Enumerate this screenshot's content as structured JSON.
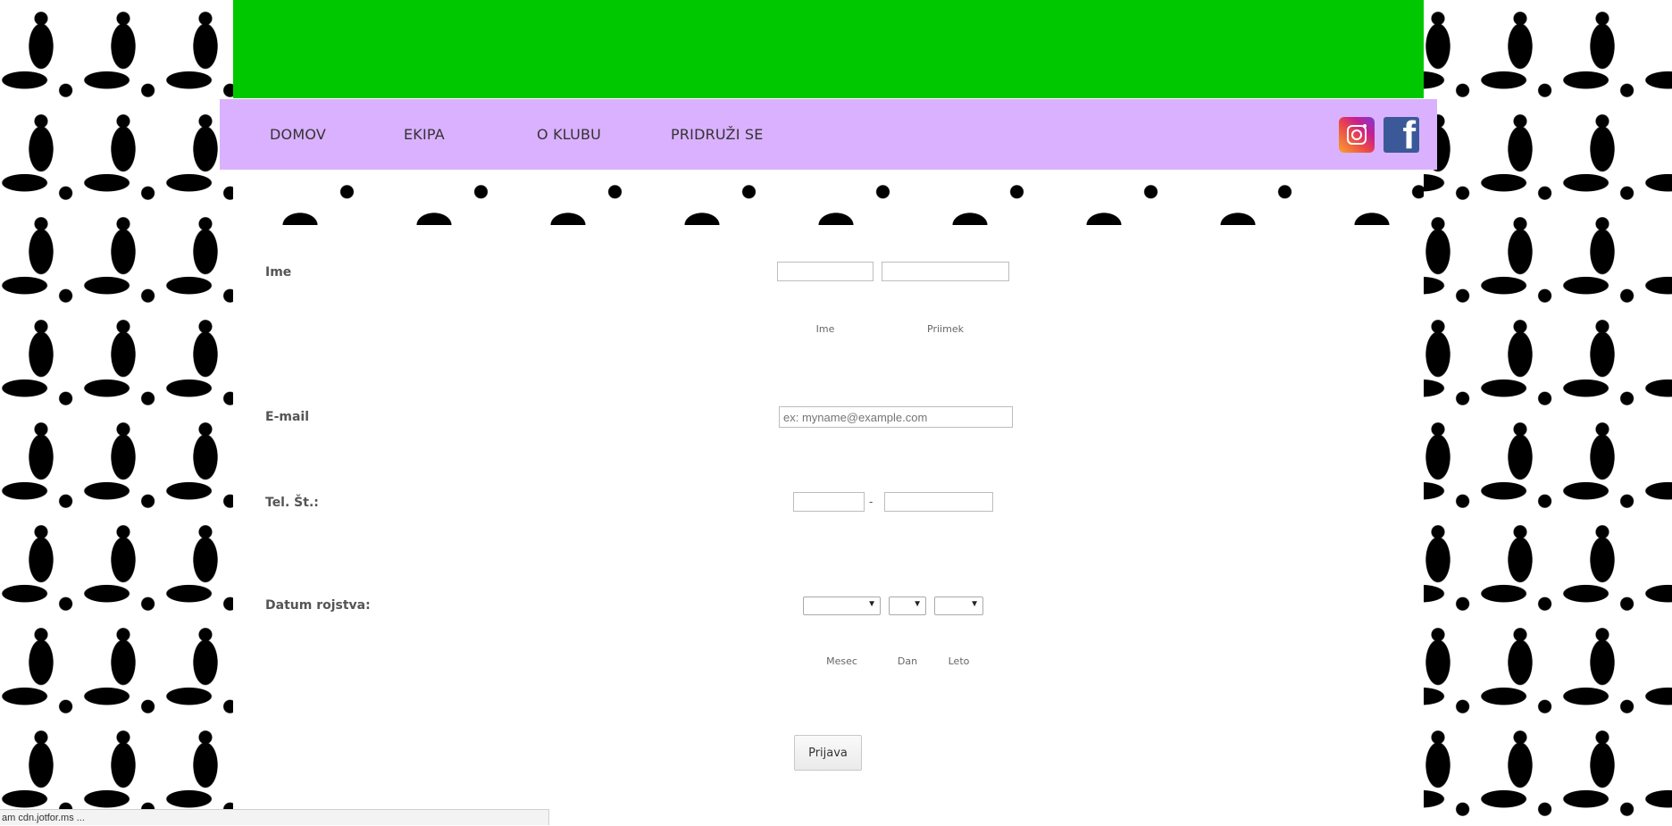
{
  "nav": {
    "items": [
      {
        "label": "DOMOV"
      },
      {
        "label": "EKIPA"
      },
      {
        "label": "O KLUBU"
      },
      {
        "label": "PRIDRUŽI SE"
      }
    ],
    "social": [
      {
        "icon": "instagram-icon"
      },
      {
        "icon": "facebook-icon"
      }
    ]
  },
  "colors": {
    "banner": "#00c800",
    "navbar": "#dab1ff",
    "facebook": "#3b5998"
  },
  "form": {
    "name": {
      "label": "Ime",
      "first_sub": "Ime",
      "last_sub": "Priimek",
      "first_value": "",
      "last_value": ""
    },
    "email": {
      "label": "E-mail",
      "placeholder": "ex: myname@example.com",
      "value": ""
    },
    "phone": {
      "label": "Tel. Št.:",
      "separator": "-",
      "area_value": "",
      "number_value": ""
    },
    "birthdate": {
      "label": "Datum rojstva:",
      "month_sub": "Mesec",
      "day_sub": "Dan",
      "year_sub": "Leto",
      "month_value": "",
      "day_value": "",
      "year_value": ""
    },
    "submit_label": "Prijava"
  },
  "status_bar": {
    "text": "am cdn.jotfor.ms ..."
  }
}
